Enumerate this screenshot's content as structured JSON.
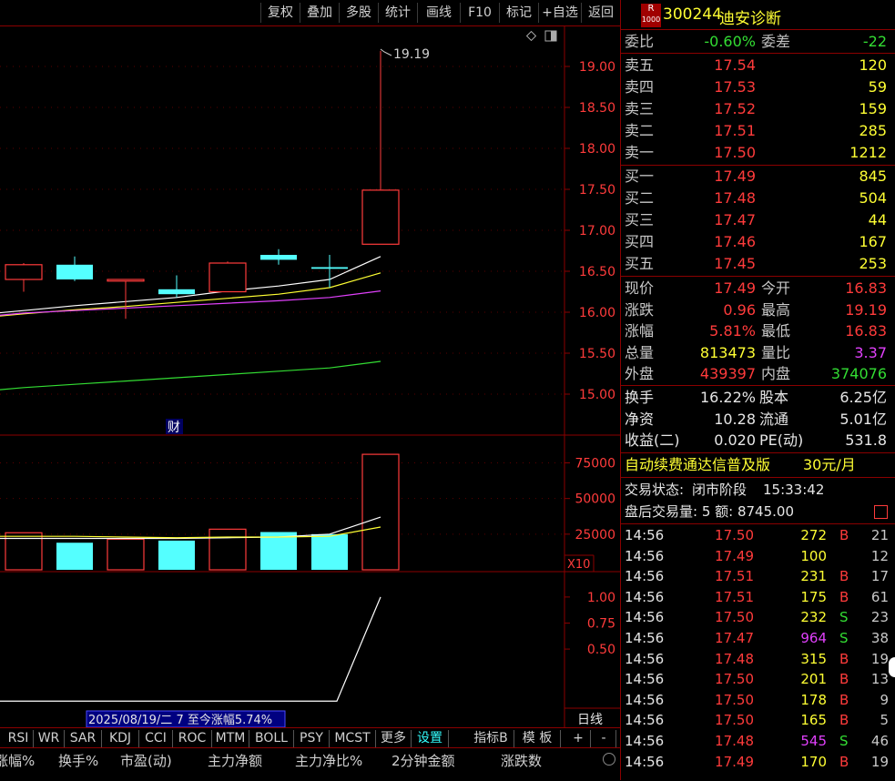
{
  "toolbar": {
    "buttons": [
      "复权",
      "叠加",
      "多股",
      "统计",
      "画线",
      "F10",
      "标记",
      "+自选",
      "返回"
    ]
  },
  "chart": {
    "high_label": "19.19",
    "finance_marker": "财",
    "date_range_label": "2025/08/19/二 7 至今涨幅5.74%",
    "vol_multiplier": "X10",
    "period_label": "日线"
  },
  "chart_data": [
    {
      "type": "candlestick",
      "title": "",
      "y_ticks": [
        "19.00",
        "18.50",
        "18.00",
        "17.50",
        "17.00",
        "16.50",
        "16.00",
        "15.50",
        "15.00"
      ],
      "ylim": [
        14.6,
        19.4
      ],
      "candles": [
        {
          "open": 16.4,
          "close": 16.58,
          "high": 16.6,
          "low": 16.25,
          "color": "red"
        },
        {
          "open": 16.58,
          "close": 16.4,
          "high": 16.68,
          "low": 16.38,
          "color": "cyan"
        },
        {
          "open": 16.38,
          "close": 16.4,
          "high": 16.4,
          "low": 15.92,
          "color": "red"
        },
        {
          "open": 16.28,
          "close": 16.22,
          "high": 16.45,
          "low": 16.18,
          "color": "cyan"
        },
        {
          "open": 16.25,
          "close": 16.6,
          "high": 16.62,
          "low": 16.25,
          "color": "red"
        },
        {
          "open": 16.7,
          "close": 16.64,
          "high": 16.77,
          "low": 16.58,
          "color": "cyan"
        },
        {
          "open": 16.55,
          "close": 16.53,
          "high": 16.7,
          "low": 16.3,
          "color": "cyan"
        },
        {
          "open": 16.83,
          "close": 17.49,
          "high": 19.19,
          "low": 16.83,
          "color": "red"
        }
      ],
      "ma_lines": [
        {
          "color": "#ffffff",
          "values": [
            16.02,
            16.08,
            16.13,
            16.18,
            16.26,
            16.32,
            16.4,
            16.68
          ]
        },
        {
          "color": "#ffff33",
          "values": [
            15.98,
            16.03,
            16.07,
            16.12,
            16.17,
            16.22,
            16.3,
            16.48
          ]
        },
        {
          "color": "#e040fb",
          "values": [
            15.99,
            16.02,
            16.05,
            16.08,
            16.11,
            16.14,
            16.18,
            16.26
          ]
        },
        {
          "color": "#33dd33",
          "values": [
            15.08,
            15.12,
            15.16,
            15.2,
            15.24,
            15.28,
            15.32,
            15.4
          ]
        }
      ]
    },
    {
      "type": "bar",
      "title": "",
      "y_ticks": [
        "75000",
        "50000",
        "25000"
      ],
      "ylim": [
        0,
        90000
      ],
      "values": [
        26000,
        19000,
        21500,
        20500,
        28500,
        26500,
        25000,
        81000
      ],
      "colors": [
        "red",
        "cyan",
        "red",
        "cyan",
        "red",
        "cyan",
        "cyan",
        "red"
      ],
      "ma_lines": [
        {
          "color": "#ffffff",
          "values": [
            22000,
            22000,
            22000,
            22000,
            22500,
            23000,
            25000,
            37000
          ]
        },
        {
          "color": "#ffff33",
          "values": [
            23500,
            23500,
            23000,
            22500,
            23000,
            23000,
            23500,
            30000
          ]
        }
      ]
    },
    {
      "type": "line",
      "title": "",
      "y_ticks": [
        "1.00",
        "0.75",
        "0.50"
      ],
      "ylim": [
        -0.05,
        1.2
      ],
      "values": [
        0,
        0,
        0,
        0,
        0,
        0,
        0,
        1.0
      ],
      "color": "#ffffff"
    }
  ],
  "indicator_tabs": [
    "RSI",
    "WR",
    "SAR",
    "KDJ",
    "CCI",
    "ROC",
    "MTM",
    "BOLL",
    "PSY",
    "MCST",
    "更多",
    "设置"
  ],
  "indicator_tools": [
    "指标B",
    "模 板",
    "+",
    "-"
  ],
  "column_headers": [
    "涨幅%",
    "换手%",
    "市盈(动)",
    "主力净额",
    "主力净比%",
    "2分钟金额",
    "涨跌数"
  ],
  "quote": {
    "code": "300244",
    "name": "迪安诊断",
    "badge_top": "R",
    "badge_bottom": "1000",
    "webi_label": "委比",
    "webi_value": "-0.60%",
    "weicha_label": "委差",
    "weicha_value": "-22",
    "asks": [
      {
        "label": "卖五",
        "price": "17.54",
        "vol": "120"
      },
      {
        "label": "卖四",
        "price": "17.53",
        "vol": "59"
      },
      {
        "label": "卖三",
        "price": "17.52",
        "vol": "159"
      },
      {
        "label": "卖二",
        "price": "17.51",
        "vol": "285"
      },
      {
        "label": "卖一",
        "price": "17.50",
        "vol": "1212"
      }
    ],
    "bids": [
      {
        "label": "买一",
        "price": "17.49",
        "vol": "845"
      },
      {
        "label": "买二",
        "price": "17.48",
        "vol": "504"
      },
      {
        "label": "买三",
        "price": "17.47",
        "vol": "44"
      },
      {
        "label": "买四",
        "price": "17.46",
        "vol": "167"
      },
      {
        "label": "买五",
        "price": "17.45",
        "vol": "253"
      }
    ],
    "stats": [
      {
        "l1": "现价",
        "v1": "17.49",
        "c1": "red",
        "l2": "今开",
        "v2": "16.83",
        "c2": "red"
      },
      {
        "l1": "涨跌",
        "v1": "0.96",
        "c1": "red",
        "l2": "最高",
        "v2": "19.19",
        "c2": "red"
      },
      {
        "l1": "涨幅",
        "v1": "5.81%",
        "c1": "red",
        "l2": "最低",
        "v2": "16.83",
        "c2": "red"
      },
      {
        "l1": "总量",
        "v1": "813473",
        "c1": "yellow",
        "l2": "量比",
        "v2": "3.37",
        "c2": "magenta"
      },
      {
        "l1": "外盘",
        "v1": "439397",
        "c1": "red",
        "l2": "内盘",
        "v2": "374076",
        "c2": "green"
      }
    ],
    "fund": [
      {
        "l1": "换手",
        "v1": "16.22%",
        "l2": "股本",
        "v2": "6.25亿"
      },
      {
        "l1": "净资",
        "v1": "10.28",
        "l2": "流通",
        "v2": "5.01亿"
      },
      {
        "l1": "收益(二)",
        "v1": "0.020",
        "l2": "PE(动)",
        "v2": "531.8"
      }
    ],
    "ad_text": "自动续费通达信普及版",
    "ad_price": "30元/月",
    "trade_status_label": "交易状态:",
    "trade_status": "闭市阶段",
    "trade_time": "15:33:42",
    "after_hours": "盘后交易量: 5  额: 8745.00"
  },
  "ticks": [
    {
      "time": "14:56",
      "price": "17.50",
      "vol": "272",
      "vc": "yellow",
      "side": "B",
      "n": "21"
    },
    {
      "time": "14:56",
      "price": "17.49",
      "vol": "100",
      "vc": "yellow",
      "side": "",
      "n": "12"
    },
    {
      "time": "14:56",
      "price": "17.51",
      "vol": "231",
      "vc": "yellow",
      "side": "B",
      "n": "17"
    },
    {
      "time": "14:56",
      "price": "17.51",
      "vol": "175",
      "vc": "yellow",
      "side": "B",
      "n": "61"
    },
    {
      "time": "14:56",
      "price": "17.50",
      "vol": "232",
      "vc": "yellow",
      "side": "S",
      "n": "23"
    },
    {
      "time": "14:56",
      "price": "17.47",
      "vol": "964",
      "vc": "magenta",
      "side": "S",
      "n": "38"
    },
    {
      "time": "14:56",
      "price": "17.48",
      "vol": "315",
      "vc": "yellow",
      "side": "B",
      "n": "19"
    },
    {
      "time": "14:56",
      "price": "17.50",
      "vol": "201",
      "vc": "yellow",
      "side": "B",
      "n": "13"
    },
    {
      "time": "14:56",
      "price": "17.50",
      "vol": "178",
      "vc": "yellow",
      "side": "B",
      "n": "9"
    },
    {
      "time": "14:56",
      "price": "17.50",
      "vol": "165",
      "vc": "yellow",
      "side": "B",
      "n": "5"
    },
    {
      "time": "14:56",
      "price": "17.48",
      "vol": "545",
      "vc": "magenta",
      "side": "S",
      "n": "46"
    },
    {
      "time": "14:56",
      "price": "17.49",
      "vol": "170",
      "vc": "yellow",
      "side": "B",
      "n": "19"
    }
  ]
}
